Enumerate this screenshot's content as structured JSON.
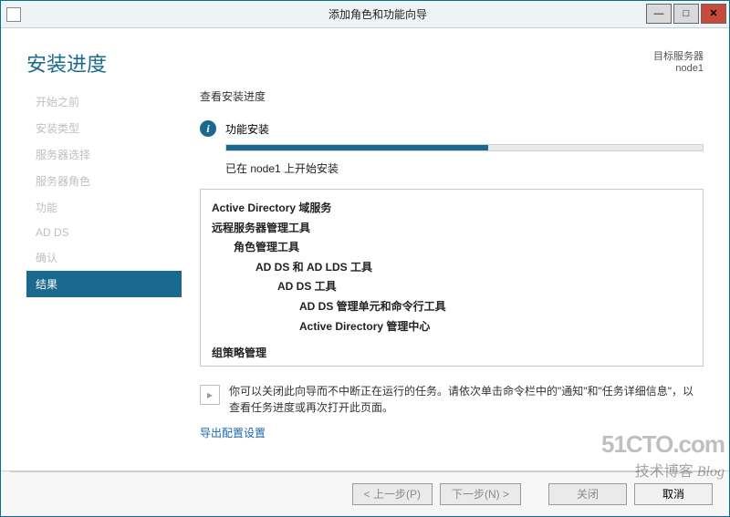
{
  "window": {
    "title": "添加角色和功能向导"
  },
  "header": {
    "page_title": "安装进度",
    "target_label": "目标服务器",
    "target_value": "node1"
  },
  "sidebar": {
    "items": [
      {
        "label": "开始之前"
      },
      {
        "label": "安装类型"
      },
      {
        "label": "服务器选择"
      },
      {
        "label": "服务器角色"
      },
      {
        "label": "功能"
      },
      {
        "label": "AD DS"
      },
      {
        "label": "确认"
      },
      {
        "label": "结果"
      }
    ],
    "active_index": 7
  },
  "main": {
    "section_label": "查看安装进度",
    "status_text": "功能安装",
    "start_text": "已在 node1 上开始安装",
    "progress_percent": 55,
    "details": {
      "l0": "Active Directory 域服务",
      "l1": "远程服务器管理工具",
      "l2": "角色管理工具",
      "l3": "AD DS 和 AD LDS 工具",
      "l4": "AD DS 工具",
      "l5a": "AD DS 管理单元和命令行工具",
      "l5b": "Active Directory 管理中心",
      "gp": "组策略管理"
    },
    "note": "你可以关闭此向导而不中断正在运行的任务。请依次单击命令栏中的\"通知\"和\"任务详细信息\"，以查看任务进度或再次打开此页面。",
    "export_link": "导出配置设置"
  },
  "footer": {
    "prev": "< 上一步(P)",
    "next": "下一步(N) >",
    "close": "关闭",
    "cancel": "取消"
  },
  "watermark": {
    "line1": "51CTO.com",
    "line2_a": "技术博客",
    "line2_b": "Blog"
  }
}
